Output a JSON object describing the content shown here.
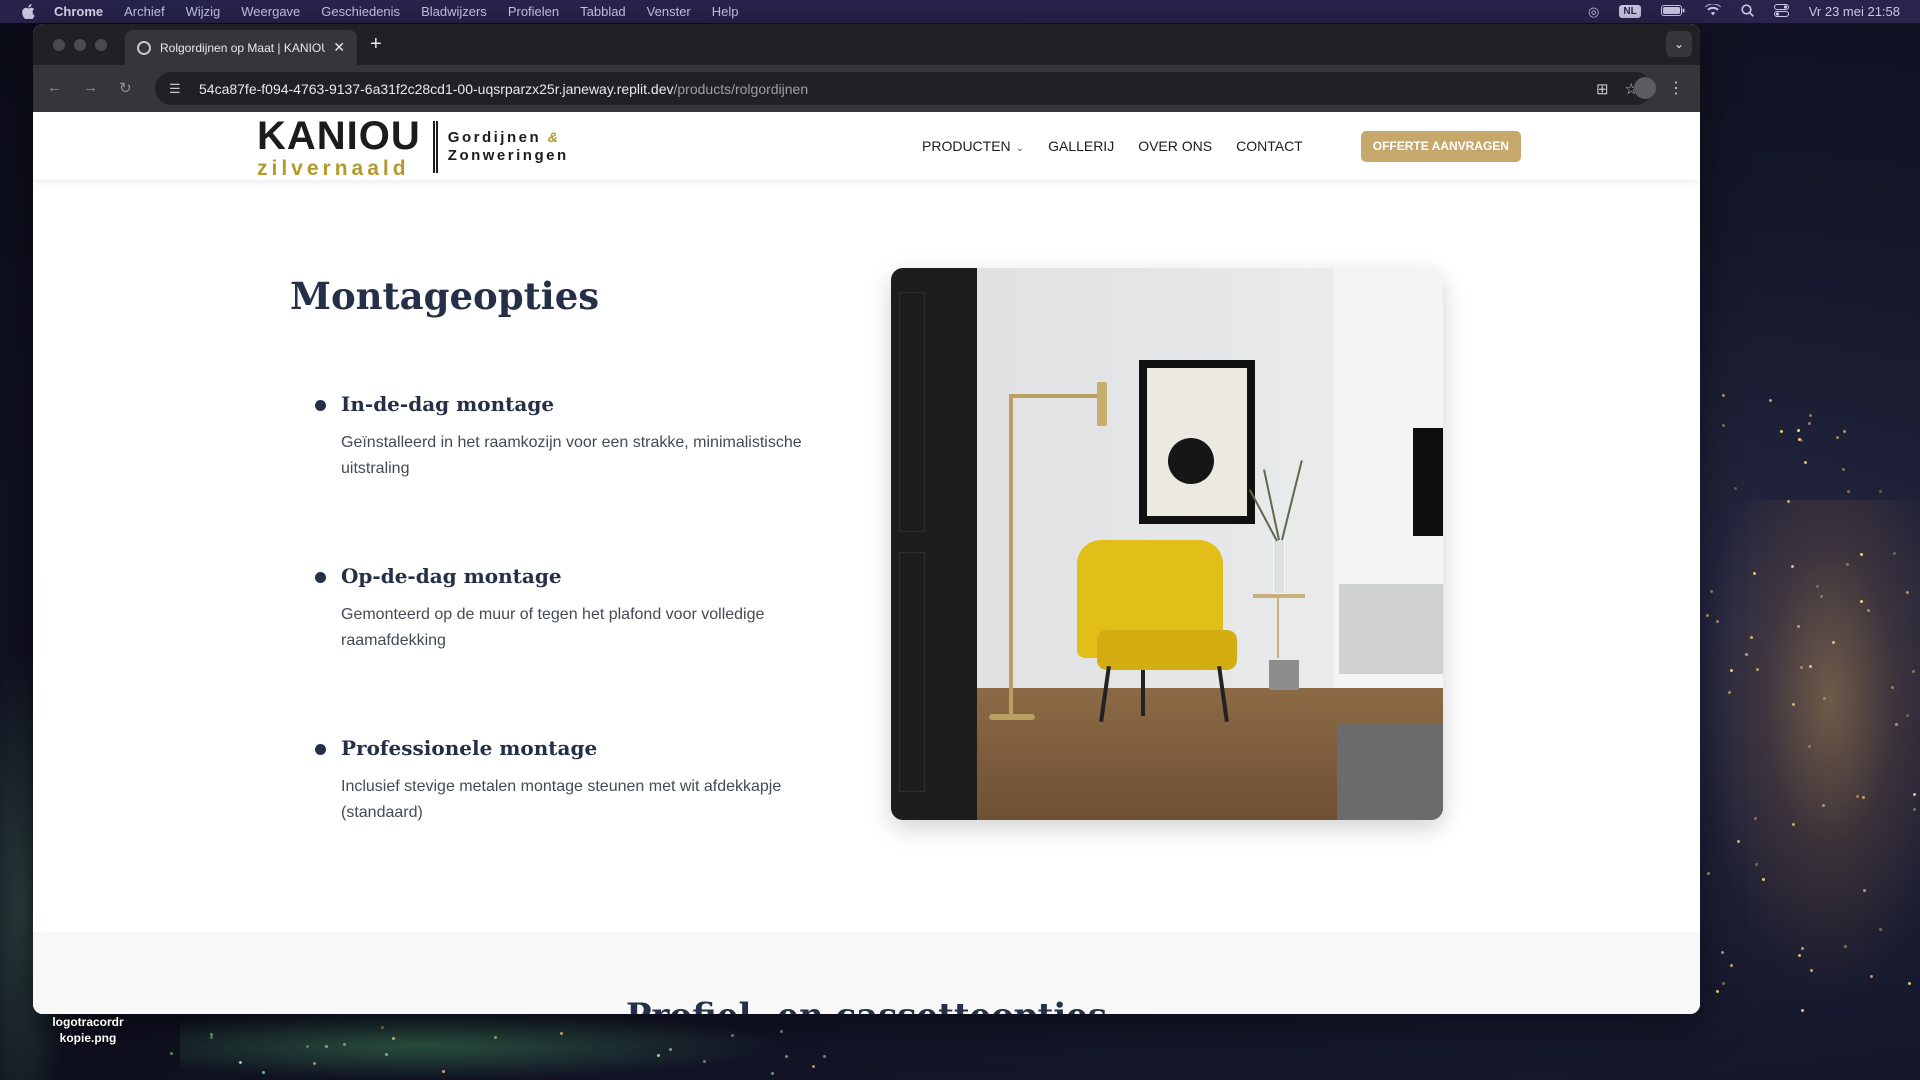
{
  "menubar": {
    "app": "Chrome",
    "items": [
      "Archief",
      "Wijzig",
      "Weergave",
      "Geschiedenis",
      "Bladwijzers",
      "Profielen",
      "Tabblad",
      "Venster",
      "Help"
    ],
    "input_source": "NL",
    "datetime": "Vr 23 mei  21:58"
  },
  "browser": {
    "tab_title": "Rolgordijnen op Maat | KANIOU",
    "url_host": "54ca87fe-f094-4763-9137-6a31f2c28cd1-00-uqsrparzx25r.janeway.replit.dev",
    "url_path": "/products/rolgordijnen"
  },
  "site": {
    "logo": {
      "name": "KANIOU",
      "sub_name": "zilvernaald",
      "tagline_1": "Gordijnen",
      "amp": "&",
      "tagline_2": "Zonweringen"
    },
    "nav": {
      "products": "PRODUCTEN",
      "gallery": "GALLERIJ",
      "about": "OVER ONS",
      "contact": "CONTACT",
      "cta": "OFFERTE AANVRAGEN"
    }
  },
  "mounting": {
    "title": "Montageopties",
    "options": [
      {
        "title": "In-de-dag montage",
        "description": "Geïnstalleerd in het raamkozijn voor een strakke, minimalistische uitstraling"
      },
      {
        "title": "Op-de-dag montage",
        "description": "Gemonteerd op de muur of tegen het plafond voor volledige raamafdekking"
      },
      {
        "title": "Professionele montage",
        "description": "Inclusief stevige metalen montage steunen met wit afdekkapje (standaard)"
      }
    ]
  },
  "next_section": {
    "title": "Profiel- en cassetteopties"
  },
  "desktop": {
    "file_label": "logotracordr kopie.png"
  },
  "colors": {
    "accent_gold": "#c7a86c",
    "heading_navy": "#243047",
    "chair_yellow": "#e2bf18"
  }
}
